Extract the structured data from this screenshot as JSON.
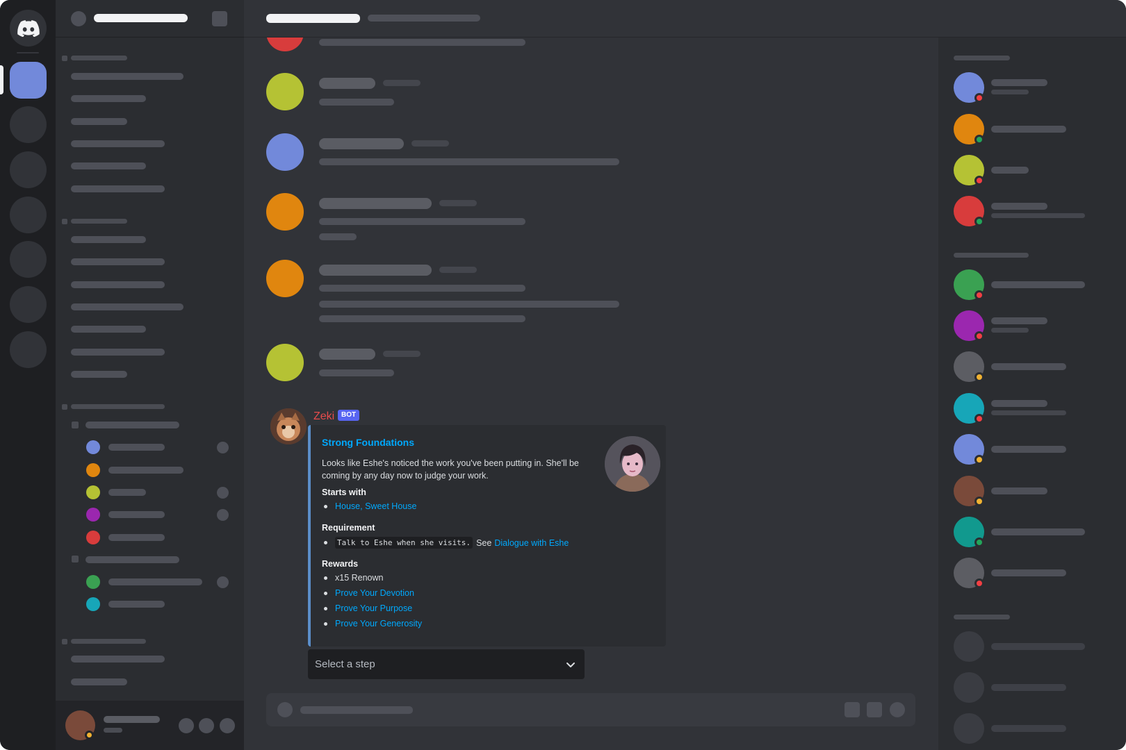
{
  "app": {
    "name": "Discord"
  },
  "bot_message": {
    "author": "Zeki",
    "tag": "BOT",
    "embed": {
      "title": "Strong Foundations",
      "description": "Looks like Eshe's noticed the work you've been putting in. She'll be coming by any day now to judge your work.",
      "starts_with": {
        "label": "Starts with",
        "items": [
          "House, Sweet House"
        ]
      },
      "requirement": {
        "label": "Requirement",
        "code": "Talk to Eshe when she visits.",
        "see_text": "See",
        "link": "Dialogue with Eshe"
      },
      "rewards": {
        "label": "Rewards",
        "plain": "x15 Renown",
        "links": [
          "Prove Your Devotion",
          "Prove Your Purpose",
          "Prove Your Generosity"
        ]
      }
    },
    "select": {
      "placeholder": "Select a step",
      "icon": "chevron-down-icon"
    }
  },
  "colors": {
    "accent": "#7289da",
    "bot_name": "#e74c4c",
    "link": "#00a8fc",
    "embed_border": "#5b8ec9",
    "online": "#23a55a",
    "dnd": "#f23f43",
    "idle": "#f0b232"
  }
}
